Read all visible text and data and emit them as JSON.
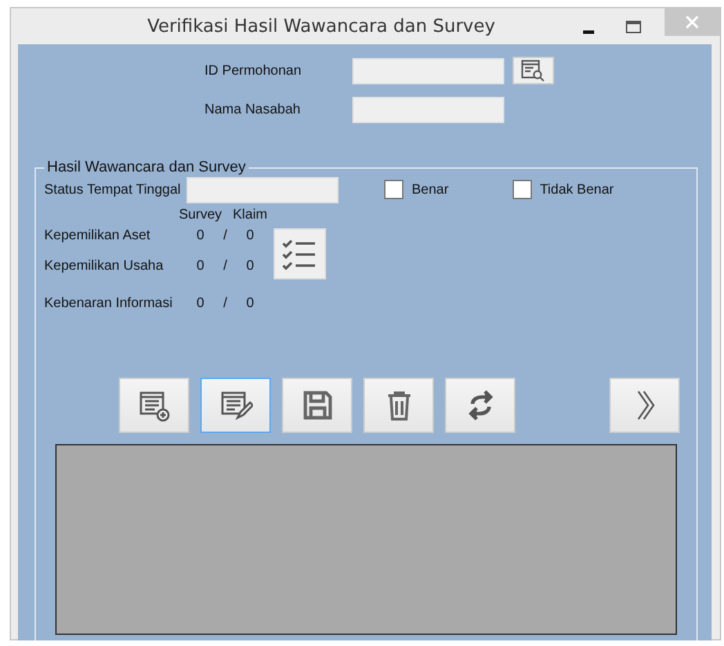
{
  "window": {
    "title": "Verifikasi Hasil Wawancara dan Survey"
  },
  "header_fields": [
    {
      "label": "ID Permohonan"
    },
    {
      "label": "Nama Nasabah"
    }
  ],
  "group": {
    "title": "Hasil Wawancara dan Survey",
    "status": {
      "label": "Status Tempat Tinggal"
    },
    "checkboxes": [
      {
        "label": "Benar",
        "checked": false
      },
      {
        "label": "Tidak Benar",
        "checked": false
      }
    ],
    "column_headers": [
      "Survey",
      "Klaim"
    ],
    "rows": [
      {
        "label": "Kepemilikan Aset",
        "survey": "0",
        "separator": "/",
        "claim": "0"
      },
      {
        "label": "Kepemilikan Usaha",
        "survey": "0",
        "separator": "/",
        "claim": "0"
      },
      {
        "label": "Kebenaran Informasi",
        "survey": "0",
        "separator": "/",
        "claim": "0"
      }
    ]
  },
  "toolbar": [
    {
      "kind": "add",
      "selected": false
    },
    {
      "kind": "edit",
      "selected": true
    },
    {
      "kind": "save",
      "selected": false
    },
    {
      "kind": "delete",
      "selected": false
    },
    {
      "kind": "refresh",
      "selected": false
    },
    {
      "kind": "next",
      "selected": false
    }
  ]
}
